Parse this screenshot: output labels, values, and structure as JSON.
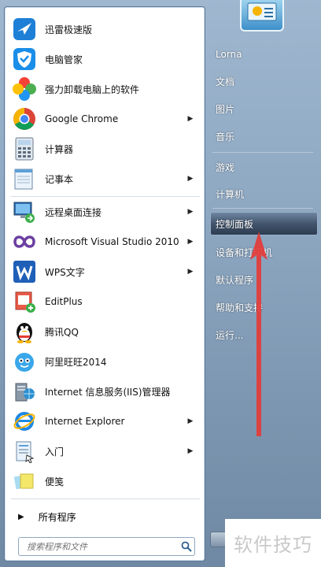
{
  "menu": {
    "items": [
      {
        "label": "迅雷极速版",
        "icon": "xunlei-bird-icon",
        "submenu": false
      },
      {
        "label": "电脑管家",
        "icon": "tencent-shield-icon",
        "submenu": false
      },
      {
        "label": "强力卸载电脑上的软件",
        "icon": "uninstall-petal-icon",
        "submenu": false
      },
      {
        "label": "Google Chrome",
        "icon": "chrome-icon",
        "submenu": true
      },
      {
        "label": "计算器",
        "icon": "calculator-icon",
        "submenu": false
      },
      {
        "label": "记事本",
        "icon": "notepad-icon",
        "submenu": true
      },
      {
        "label": "远程桌面连接",
        "icon": "remote-desktop-icon",
        "submenu": true
      },
      {
        "label": "Microsoft Visual Studio 2010",
        "icon": "visual-studio-icon",
        "submenu": true
      },
      {
        "label": "WPS文字",
        "icon": "wps-icon",
        "submenu": true
      },
      {
        "label": "EditPlus",
        "icon": "editplus-icon",
        "submenu": false
      },
      {
        "label": "腾讯QQ",
        "icon": "qq-penguin-icon",
        "submenu": false
      },
      {
        "label": "阿里旺旺2014",
        "icon": "aliwangwang-icon",
        "submenu": false
      },
      {
        "label": "Internet 信息服务(IIS)管理器",
        "icon": "iis-manager-icon",
        "submenu": false
      },
      {
        "label": "Internet Explorer",
        "icon": "internet-explorer-icon",
        "submenu": true
      },
      {
        "label": "入门",
        "icon": "getting-started-icon",
        "submenu": true
      },
      {
        "label": "便笺",
        "icon": "sticky-notes-icon",
        "submenu": false
      }
    ],
    "all_programs": "所有程序",
    "search_placeholder": "搜索程序和文件"
  },
  "right_pane": {
    "items": [
      {
        "label": "Lorna",
        "highlighted": false
      },
      {
        "label": "文档",
        "highlighted": false
      },
      {
        "label": "图片",
        "highlighted": false
      },
      {
        "label": "音乐",
        "highlighted": false
      },
      {
        "label": "游戏",
        "highlighted": false
      },
      {
        "label": "计算机",
        "highlighted": false
      },
      {
        "label": "控制面板",
        "highlighted": true
      },
      {
        "label": "设备和打印机",
        "highlighted": false
      },
      {
        "label": "默认程序",
        "highlighted": false
      },
      {
        "label": "帮助和支持",
        "highlighted": false
      },
      {
        "label": "运行...",
        "highlighted": false
      }
    ]
  },
  "watermark": "软件技巧",
  "colors": {
    "highlight": "#42556d",
    "arrow": "#e53935"
  }
}
